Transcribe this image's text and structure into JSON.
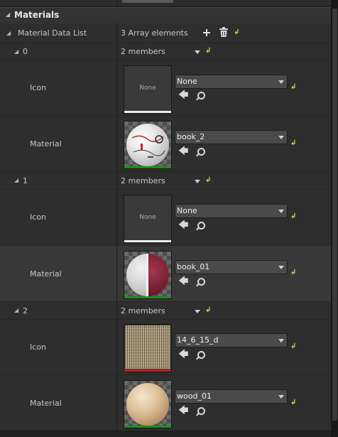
{
  "category": {
    "title": "Materials"
  },
  "material_data_list": {
    "label": "Material Data List",
    "summary": "3 Array elements"
  },
  "elements": [
    {
      "index": "0",
      "summary": "2 members",
      "icon": {
        "label": "Icon",
        "thumb_text": "None",
        "value": "None"
      },
      "material": {
        "label": "Material",
        "value": "book_2"
      }
    },
    {
      "index": "1",
      "summary": "2 members",
      "icon": {
        "label": "Icon",
        "thumb_text": "None",
        "value": "None"
      },
      "material": {
        "label": "Material",
        "value": "book_01"
      }
    },
    {
      "index": "2",
      "summary": "2 members",
      "icon": {
        "label": "Icon",
        "value": "14_6_15_d"
      },
      "material": {
        "label": "Material",
        "value": "wood_01"
      }
    }
  ],
  "icons": {
    "collapse": "expanded-triangle-icon",
    "add": "plus-icon",
    "delete": "trash-icon",
    "reset": "reset-to-default-icon",
    "use_selected": "arrow-left-icon",
    "browse": "search-icon"
  },
  "colors": {
    "texture_underline": "#c01e1e",
    "material_underline": "#1e8c1e",
    "none_underline": "#f0f0f0",
    "reset_yellow": "#e6d64a"
  }
}
